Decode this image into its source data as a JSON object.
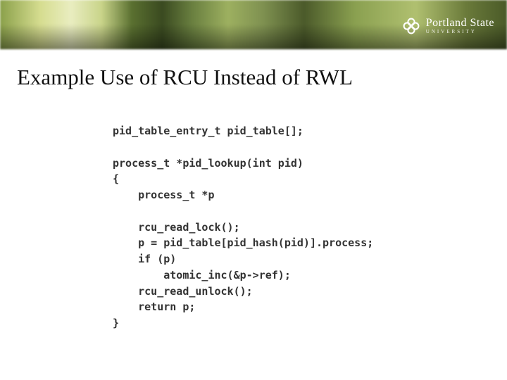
{
  "logo": {
    "name": "Portland State",
    "sub": "UNIVERSITY"
  },
  "title": "Example Use of RCU Instead of RWL",
  "code": {
    "lines": [
      "pid_table_entry_t pid_table[];",
      "",
      "process_t *pid_lookup(int pid)",
      "{",
      "    process_t *p",
      "",
      "    rcu_read_lock();",
      "    p = pid_table[pid_hash(pid)].process;",
      "    if (p)",
      "        atomic_inc(&p->ref);",
      "    rcu_read_unlock();",
      "    return p;",
      "}"
    ]
  }
}
